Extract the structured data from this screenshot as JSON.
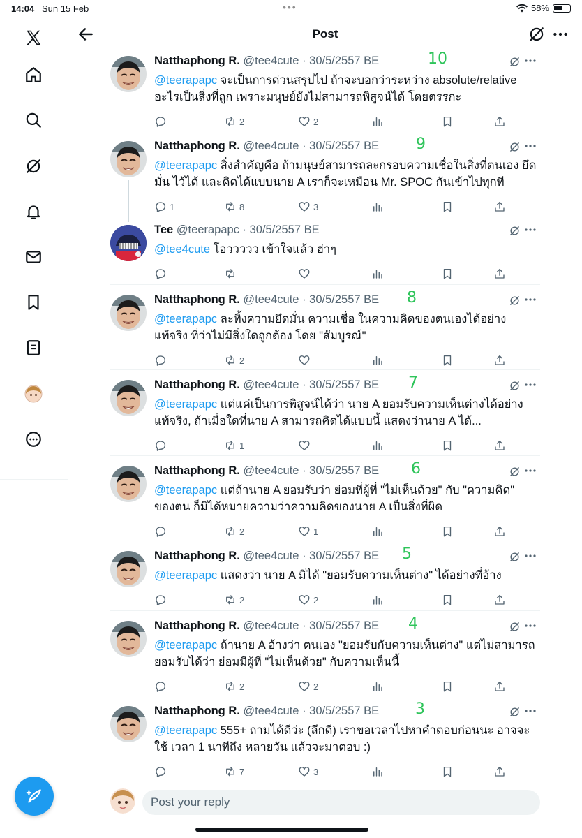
{
  "status_bar": {
    "time": "14:04",
    "date": "Sun 15 Feb",
    "battery": "58%"
  },
  "header": {
    "title": "Post"
  },
  "sidebar": {
    "icons": [
      "x-logo-icon",
      "home-icon",
      "search-icon",
      "grok-icon",
      "notifications-icon",
      "messages-icon",
      "bookmarks-icon",
      "lists-icon",
      "profile-avatar",
      "more-icon"
    ]
  },
  "posts": [
    {
      "name": "Natthaphong R.",
      "handle": "@tee4cute",
      "date": "30/5/2557 BE",
      "annotation": "10",
      "mention": "@teerapapc",
      "text": " จะเป็นการด่วนสรุปไป ถ้าจะบอกว่าระหว่าง absolute/relative อะไรเป็นสิ่งที่ถูก เพราะมนุษย์ยังไม่สามารถพิสูจน์ได้ โดยตรรกะ",
      "replies": "",
      "reposts": "2",
      "likes": "2"
    },
    {
      "name": "Natthaphong R.",
      "handle": "@tee4cute",
      "date": "30/5/2557 BE",
      "annotation": "9",
      "mention": "@teerapapc",
      "text": " สิ่งสำคัญคือ ถ้ามนุษย์สามารถละกรอบความเชื่อในสิ่งที่ตนเอง ยึดมั่น ไว้ได้ และคิดได้แบบนาย A เราก็จะเหมือน Mr. SPOC กันเข้าไปทุกที",
      "replies": "1",
      "reposts": "8",
      "likes": "3"
    },
    {
      "name": "Tee",
      "handle": "@teerapapc",
      "date": "30/5/2557 BE",
      "annotation": "",
      "mention": "@tee4cute",
      "text": " โอววววว เข้าใจแล้ว ฮ่าๆ",
      "replies": "",
      "reposts": "",
      "likes": ""
    },
    {
      "name": "Natthaphong R.",
      "handle": "@tee4cute",
      "date": "30/5/2557 BE",
      "annotation": "8",
      "mention": "@teerapapc",
      "text": " ละทิ้งความยึดมั่น ความเชื่อ ในความคิดของตนเองได้อย่างแท้จริง ที่ว่าไม่มีสิ่งใดถูกต้อง โดย \"สัมบูรณ์\"",
      "replies": "",
      "reposts": "2",
      "likes": ""
    },
    {
      "name": "Natthaphong R.",
      "handle": "@tee4cute",
      "date": "30/5/2557 BE",
      "annotation": "7",
      "mention": "@teerapapc",
      "text": " แต่แค่เป็นการพิสูจน์ได้ว่า นาย A ยอมรับความเห็นต่างได้อย่าง แท้จริง, ถ้าเมื่อใดที่นาย A สามารถคิดได้แบบนี้ แสดงว่านาย A ได้...",
      "replies": "",
      "reposts": "1",
      "likes": ""
    },
    {
      "name": "Natthaphong R.",
      "handle": "@tee4cute",
      "date": "30/5/2557 BE",
      "annotation": "6",
      "mention": "@teerapapc",
      "text": " แต่ถ้านาย A ยอมรับว่า ย่อมที่ผู้ที่ \"ไม่เห็นด้วย\" กับ \"ความคิด\" ของตน ก็มิได้หมายความว่าความคิดของนาย A เป็นสิ่งที่ผิด",
      "replies": "",
      "reposts": "2",
      "likes": "1"
    },
    {
      "name": "Natthaphong R.",
      "handle": "@tee4cute",
      "date": "30/5/2557 BE",
      "annotation": "5",
      "mention": "@teerapapc",
      "text": " แสดงว่า นาย A มิได้ \"ยอมรับความเห็นต่าง\" ได้อย่างที่อ้าง",
      "replies": "",
      "reposts": "2",
      "likes": "2"
    },
    {
      "name": "Natthaphong R.",
      "handle": "@tee4cute",
      "date": "30/5/2557 BE",
      "annotation": "4",
      "mention": "@teerapapc",
      "text": " ถ้านาย A อ้างว่า ตนเอง \"ยอมรับกับความเห็นต่าง\" แต่ไม่สามารถ ยอมรับได้ว่า ย่อมมีผู้ที่ \"ไม่เห็นด้วย\" กับความเห็นนี้",
      "replies": "",
      "reposts": "2",
      "likes": "2"
    },
    {
      "name": "Natthaphong R.",
      "handle": "@tee4cute",
      "date": "30/5/2557 BE",
      "annotation": "3",
      "mention": "@teerapapc",
      "text": " 555+ ถามได้ดีว่ะ (ลึกดี) เราขอเวลาไปหาคำตอบก่อนนะ อาจจะใช้ เวลา 1 นาทีถึง หลายวัน แล้วจะมาตอบ :)",
      "replies": "",
      "reposts": "7",
      "likes": "3"
    }
  ],
  "reply_bar": {
    "placeholder": "Post your reply"
  },
  "colors": {
    "accent": "#1d9bf0",
    "annotation": "#2ec45a",
    "text": "#0f1419",
    "muted": "#536471"
  }
}
